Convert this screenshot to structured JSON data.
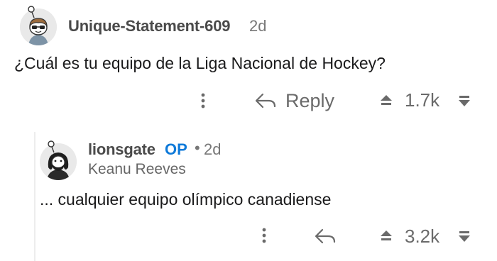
{
  "comments": [
    {
      "username": "Unique-Statement-609",
      "age": "2d",
      "body": "¿Cuál es tu equipo de la Liga Nacional de Hockey?",
      "reply_label": "Reply",
      "score": "1.7k"
    },
    {
      "username": "lionsgate",
      "op_badge": "OP",
      "separator": "•",
      "age": "2d",
      "flair": "Keanu Reeves",
      "body": "... cualquier equipo olímpico canadiense",
      "score": "3.2k"
    }
  ],
  "icons": {
    "more": "more-vertical-icon",
    "reply": "reply-arrow-icon",
    "upvote": "upvote-arrow-icon",
    "downvote": "downvote-arrow-icon"
  },
  "colors": {
    "op_badge": "#0f7ad9",
    "meta_gray": "#777777",
    "action_gray": "#6a6a6a"
  }
}
